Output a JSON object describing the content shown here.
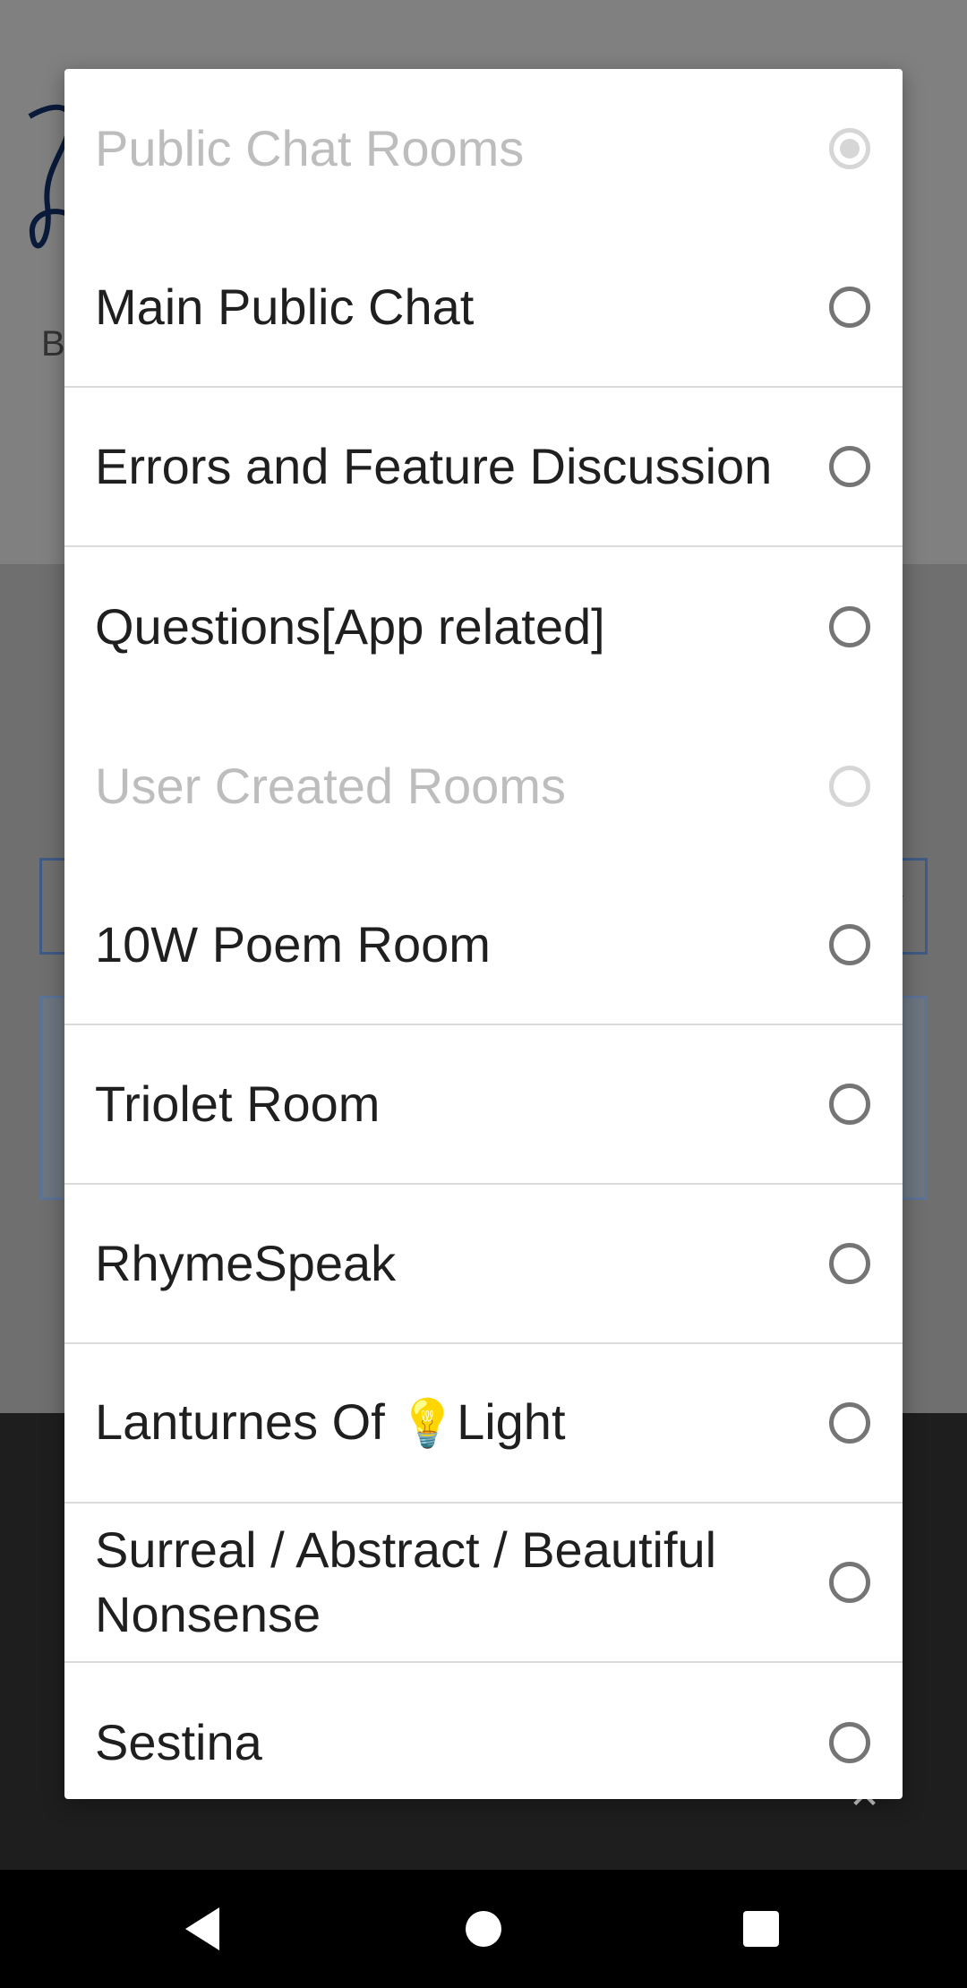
{
  "background": {
    "partial_letter": "B",
    "dropdown_arrow": "▼",
    "close_glyph": "✕"
  },
  "dialog": {
    "items": [
      {
        "label": "Public Chat Rooms",
        "type": "section",
        "selected": true
      },
      {
        "label": "Main Public Chat",
        "type": "option",
        "selected": false
      },
      {
        "label": "Errors and Feature Discussion",
        "type": "option",
        "selected": false
      },
      {
        "label": "Questions[App related]",
        "type": "option",
        "selected": false
      },
      {
        "label": "User Created Rooms",
        "type": "section",
        "selected": false
      },
      {
        "label": "10W Poem Room",
        "type": "option",
        "selected": false
      },
      {
        "label": "Triolet Room",
        "type": "option",
        "selected": false
      },
      {
        "label": "RhymeSpeak",
        "type": "option",
        "selected": false
      },
      {
        "label_before": "Lanturnes Of ",
        "emoji": "💡",
        "label_after": "Light",
        "type": "option",
        "selected": false
      },
      {
        "label": "Surreal / Abstract / Beautiful Nonsense",
        "type": "option",
        "selected": false
      },
      {
        "label": "Sestina",
        "type": "option",
        "selected": false
      }
    ]
  },
  "navbar": {
    "icons": [
      "back-icon",
      "home-icon",
      "recents-icon"
    ]
  }
}
